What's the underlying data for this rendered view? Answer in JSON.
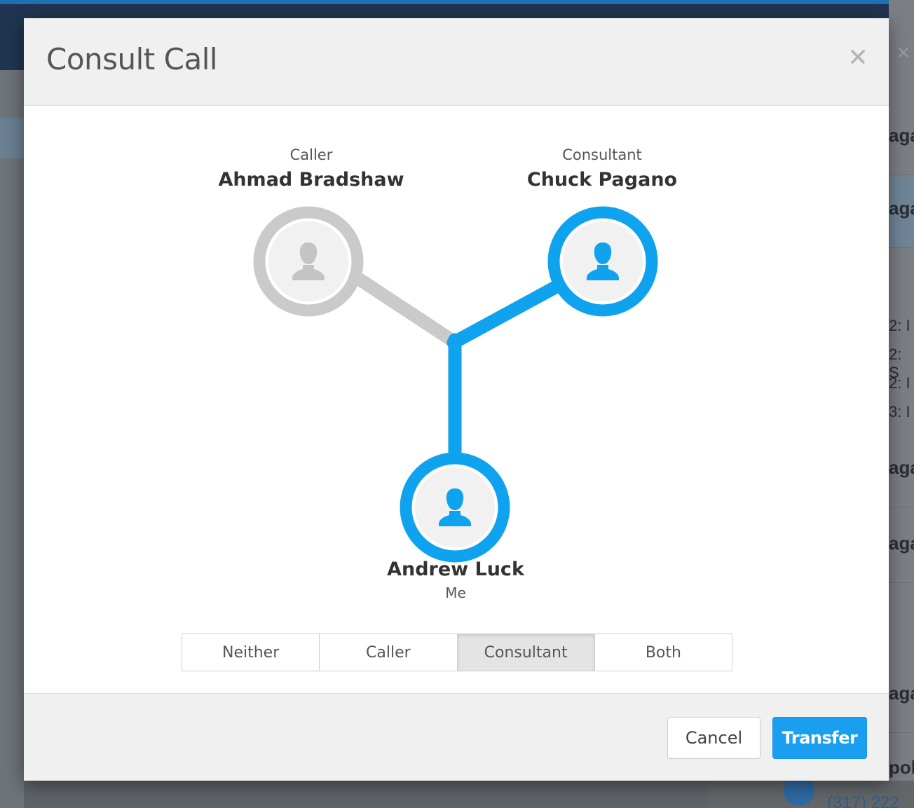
{
  "background": {
    "right_panel_rows": [
      "aga",
      "aga",
      "aga",
      "aga",
      "aga",
      "pol"
    ],
    "right_panel_lines": [
      "2: I",
      "2: S",
      "2: I",
      "3: I"
    ],
    "phone_fragment": "(317) 222"
  },
  "modal": {
    "title": "Consult Call",
    "close_icon": "close-icon"
  },
  "parties": {
    "caller": {
      "role": "Caller",
      "name": "Ahmad Bradshaw",
      "connected": false
    },
    "consultant": {
      "role": "Consultant",
      "name": "Chuck Pagano",
      "connected": true
    },
    "me": {
      "name": "Andrew Luck",
      "role": "Me",
      "connected": true
    }
  },
  "icons": {
    "avatar": "person-icon"
  },
  "colors": {
    "active": "#0fa3ef",
    "inactive": "#cacaca",
    "avatar_fill_active": "#0fa3ef",
    "avatar_fill_inactive": "#c4c4c4",
    "primary_button": "#1a9ff0"
  },
  "listen_options": {
    "options": [
      "Neither",
      "Caller",
      "Consultant",
      "Both"
    ],
    "selected": "Consultant"
  },
  "footer": {
    "cancel_label": "Cancel",
    "transfer_label": "Transfer"
  }
}
